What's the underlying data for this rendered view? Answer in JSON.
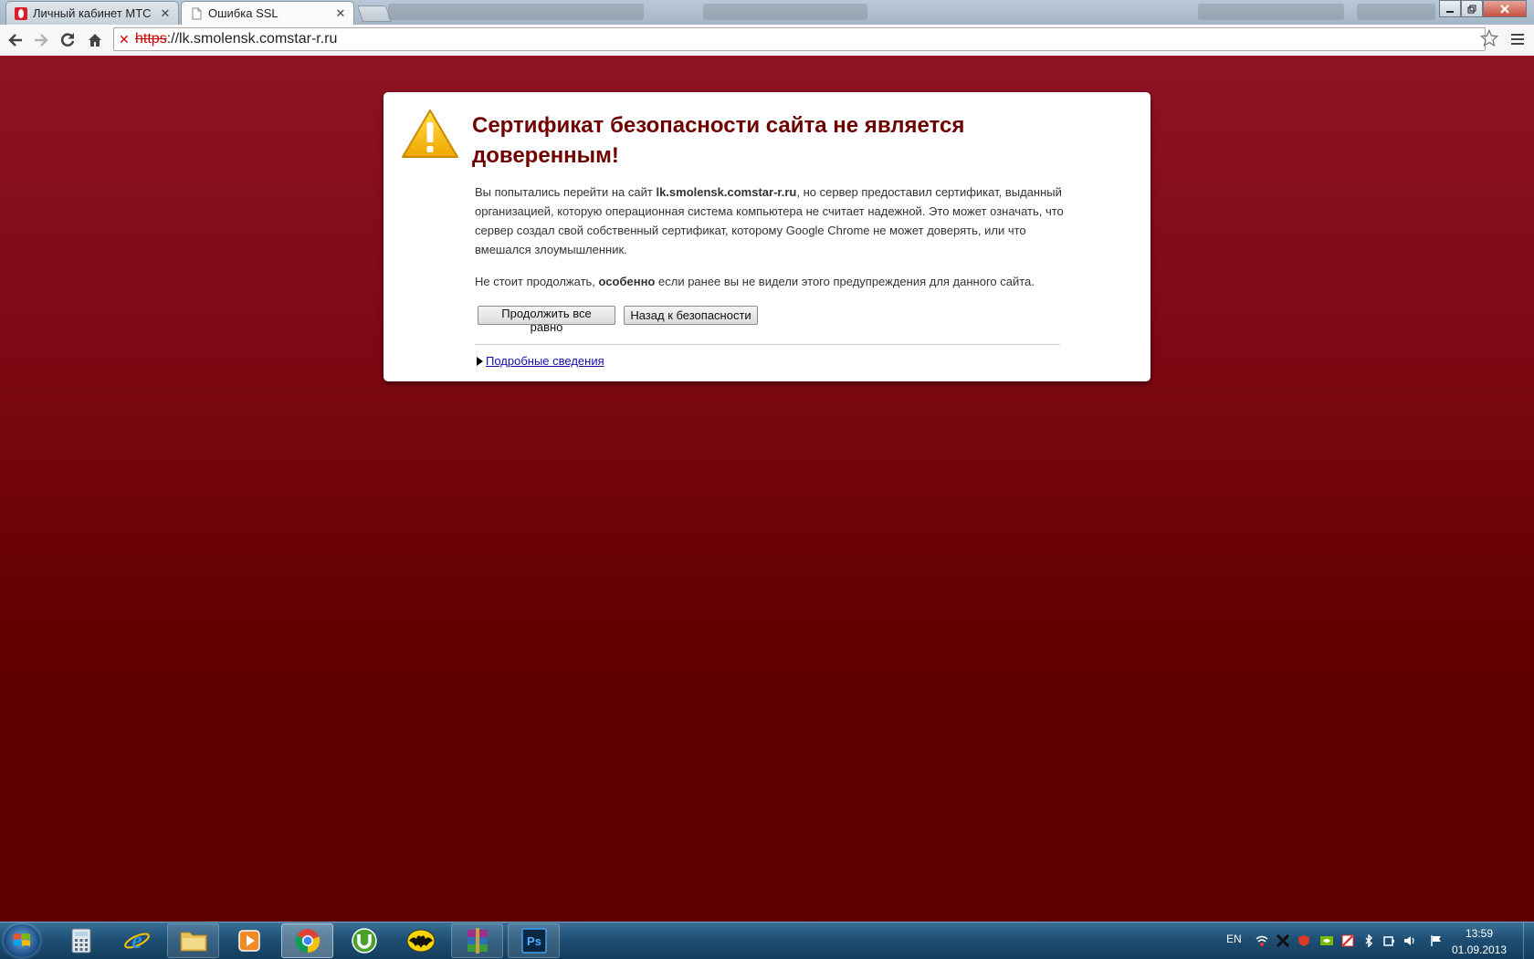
{
  "browser": {
    "tabs": [
      {
        "title": "Личный кабинет МТС",
        "active": false
      },
      {
        "title": "Ошибка SSL",
        "active": true
      }
    ],
    "url_scheme": "https",
    "url_separator": "://",
    "url_host": "lk.smolensk.comstar-r.ru"
  },
  "page": {
    "heading": "Сертификат безопасности сайта не является доверенным!",
    "p1_before": "Вы попытались перейти на сайт ",
    "p1_host": "lk.smolensk.comstar-r.ru",
    "p1_after": ", но сервер предоставил сертификат, выданный организацией, которую операционная система компьютера не считает надежной. Это может означать, что сервер создал свой собственный сертификат, которому Google Chrome не может доверять, или что вмешался злоумышленник.",
    "p2_before": "Не стоит продолжать, ",
    "p2_bold": "особенно",
    "p2_after": " если ранее вы не видели этого предупреждения для данного сайта.",
    "proceed_label": "Продолжить все равно",
    "back_label": "Назад к безопасности",
    "details_label": "Подробные сведения"
  },
  "taskbar": {
    "language": "EN",
    "time": "13:59",
    "date": "01.09.2013"
  },
  "colors": {
    "heading": "#6f0000",
    "page_top": "#8f1225",
    "page_bottom": "#5e0000",
    "link": "#1a0dab"
  }
}
